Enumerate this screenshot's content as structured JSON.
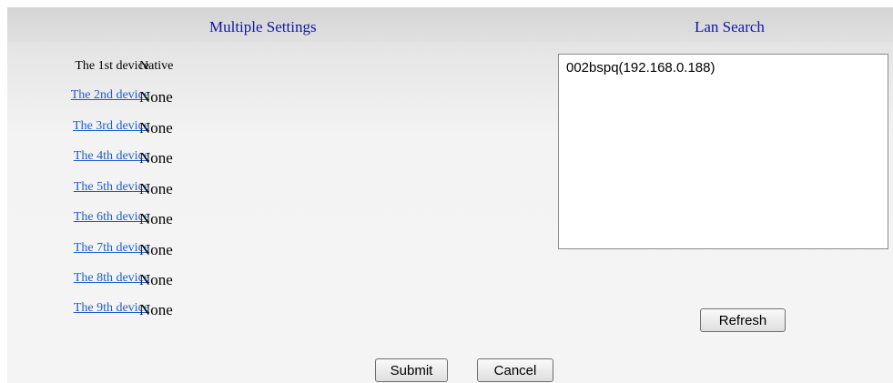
{
  "titles": {
    "multiple_settings": "Multiple Settings",
    "lan_search": "Lan Search"
  },
  "devices": [
    {
      "label": "The 1st device",
      "value": "Native"
    },
    {
      "label": "The 2nd device",
      "value": "None"
    },
    {
      "label": "The 3rd device",
      "value": "None"
    },
    {
      "label": "The 4th device",
      "value": "None"
    },
    {
      "label": "The 5th device",
      "value": "None"
    },
    {
      "label": "The 6th device",
      "value": "None"
    },
    {
      "label": "The 7th device",
      "value": "None"
    },
    {
      "label": "The 8th device",
      "value": "None"
    },
    {
      "label": "The 9th device",
      "value": "None"
    }
  ],
  "lan_results": [
    "002bspq(192.168.0.188)"
  ],
  "buttons": {
    "refresh": "Refresh",
    "submit": "Submit",
    "cancel": "Cancel"
  }
}
